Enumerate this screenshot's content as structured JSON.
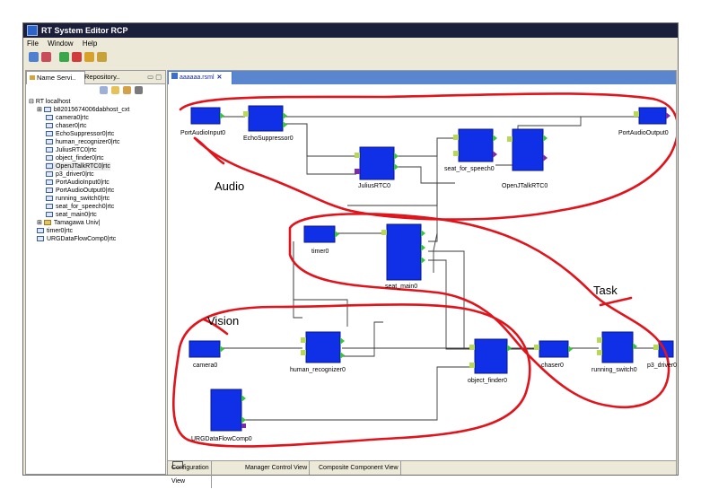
{
  "window": {
    "title": "RT System Editor RCP"
  },
  "menu": [
    "File",
    "Window",
    "Help"
  ],
  "left_panel": {
    "tabs": [
      "Name Servi..",
      "Repository.."
    ],
    "tree": [
      "RT localhost",
      "b82015674006dabhost_cxt",
      "camera0|rtc",
      "chaser0|rtc",
      "EchoSuppressor0|rtc",
      "human_recognizer0|rtc",
      "JuliusRTC0|rtc",
      "object_finder0|rtc",
      "OpenJTalkRTC0|rtc",
      "p3_driver0|rtc",
      "PortAudioInput0|rtc",
      "PortAudioOutput0|rtc",
      "running_switch0|rtc",
      "seat_for_speech0|rtc",
      "seat_main0|rtc",
      "Tamagawa Univ|",
      "timer0|rtc",
      "URGDataFlowComp0|rtc"
    ]
  },
  "editor": {
    "tab_label": "aaaaaa.rsml",
    "components": {
      "portaudio_input": "PortAudioInput0",
      "echo_suppressor": "EchoSuppressor0",
      "portaudio_output": "PortAudioOutput0",
      "julius": "JuliusRTC0",
      "seat_for_speech": "seat_for_speech0",
      "openjtalk": "OpenJTalkRTC0",
      "timer": "timer0",
      "seat_main": "seat_main0",
      "camera": "camera0",
      "human_recognizer": "human_recognizer0",
      "object_finder": "object_finder0",
      "chaser": "chaser0",
      "running_switch": "running_switch0",
      "p3_driver": "p3_driver0",
      "urg": "URGDataFlowComp0"
    },
    "annotations": {
      "audio": "Audio",
      "task": "Task",
      "vision": "Vision"
    },
    "annotation_color": "#e0141c",
    "component_color": "#1030e8"
  },
  "bottom_tabs": [
    "Configuration View",
    "Manager Control View",
    "Composite Component View"
  ]
}
